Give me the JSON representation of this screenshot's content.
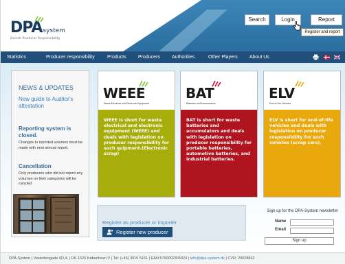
{
  "logo": {
    "main": "DPA",
    "sub": "system",
    "tagline": "Danish Producer Responsibility"
  },
  "header": {
    "search_label": "Search",
    "login_label": "Login",
    "report_label": "Report",
    "tooltip": "Register and report"
  },
  "nav": {
    "items": [
      "Statistics",
      "Producer responsibility",
      "Products",
      "Producers",
      "Authorities",
      "Other Players",
      "About Us"
    ],
    "icons": [
      "print-icon",
      "danish-flag-icon",
      "uk-flag-icon"
    ]
  },
  "news": {
    "title": "NEWS & UPDATES",
    "link": "New guide to Auditor's attestation",
    "h1": "Reporting system is closed.",
    "p1": "Changes to reported volumes must be made with next annual report.",
    "h2": "Cancellation",
    "p2": "Only producers who did not report any volumes on their categories will be cancled."
  },
  "cards": [
    {
      "logo": "WEEE",
      "sub": "Waste Electrical and Electronic Equipment",
      "text": "WEEE is short for waste electrical and electronic equipment (WEEE) and deals with legislation on producer responsibility for such quipment.(Electronic scrap)",
      "color": "#a7ae0c"
    },
    {
      "logo": "BAT",
      "sub": "Batteries and Accumulators",
      "text": "BAT is short for waste batteries and accumulators and deals with legislation on producer responsibility for portable batteries, automotive batteries, and industrial batteries.",
      "color": "#b0141e"
    },
    {
      "logo": "ELV",
      "sub": "End-of-Life Vehicles",
      "text": "ELV is short for end-of-life vehicles and deals with legislation on producer responsibility for such vehicles (scrap cars).",
      "color": "#e9a80c"
    }
  ],
  "register": {
    "title": "Register as producer or importer",
    "button": "Register new producer"
  },
  "newsletter": {
    "title": "Sign up for the DPA-System newsletter",
    "name_label": "Name",
    "email_label": "Email",
    "button": "Sign up"
  },
  "footer": {
    "company": "DPA-System",
    "address": "Vesterbrogade 6D,4.",
    "city": "DK-1620 København V",
    "phone": "Tel: (+45) 3915 5161",
    "ean": "EAN:5790002305924",
    "email": "info@dpa-system.dk",
    "cvr": "CVR: 29028842"
  }
}
